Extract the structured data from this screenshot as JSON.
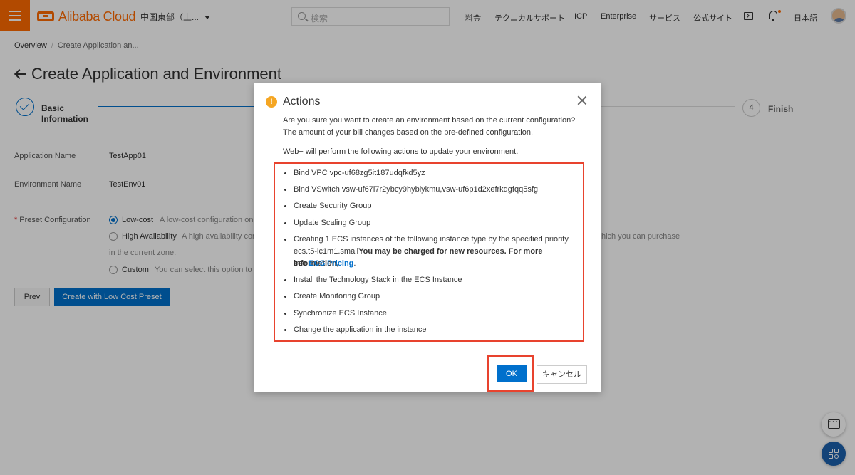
{
  "header": {
    "logo_text": "Alibaba Cloud",
    "region": "中国東部（上...",
    "search_placeholder": "検索",
    "nav": [
      "料金",
      "テクニカルサポート",
      "ICP",
      "Enterprise",
      "サービス",
      "公式サイト"
    ],
    "language": "日本語"
  },
  "breadcrumb": {
    "items": [
      "Overview",
      "Create Application an..."
    ]
  },
  "page_title": "Create Application and Environment",
  "steps": {
    "step1_label": "Basic Information",
    "step4_number": "4",
    "step4_label": "Finish"
  },
  "form": {
    "application_name_label": "Application Name",
    "application_name_value": "TestApp01",
    "environment_name_label": "Environment Name",
    "environment_name_value": "TestEnv01",
    "preset_label": "Preset Configuration",
    "preset_options": [
      {
        "label": "Low-cost",
        "desc": "A low-cost configuration onl",
        "selected": true
      },
      {
        "label": "High Availability",
        "desc": "A high availability con",
        "selected": false
      },
      {
        "label": "Custom",
        "desc": "You can select this option to a",
        "selected": false
      }
    ],
    "high_availability_desc_tail": "hich you can purchase",
    "high_availability_desc_line2": "in the current zone."
  },
  "buttons": {
    "prev": "Prev",
    "create": "Create with Low Cost Preset"
  },
  "modal": {
    "title": "Actions",
    "line1": "Are you sure you want to create an environment based on the current configuration?",
    "line2": "The amount of your bill changes based on the pre-defined configuration.",
    "line3": "Web+ will perform the following actions to update your environment.",
    "actions": [
      "Bind VPC vpc-uf68zg5it187udqfkd5yz",
      "Bind VSwitch vsw-uf67i7r2ybcy9hybiykmu,vsw-uf6p1d2xefrkqgfqq5sfg",
      "Create Security Group",
      "Update Scaling Group",
      "Creating 1 ECS instances of the following instance type by the specified priority.",
      "Install the Technology Stack in the ECS Instance",
      "Create Monitoring Group",
      "Synchronize ECS Instance",
      "Change the application in the instance"
    ],
    "ecs_instance_type": "ecs.t5-lc1m1.small",
    "ecs_charge_note": "You may be charged for new resources. For more information,",
    "ecs_see": "see ",
    "ecs_pricing_link": "ECS Pricing",
    "ecs_period": ".",
    "ok": "OK",
    "cancel": "キャンセル"
  },
  "colors": {
    "brand": "#ff6a00",
    "primary": "#0070cc",
    "highlight": "#e8432e",
    "warning": "#f5a623"
  }
}
